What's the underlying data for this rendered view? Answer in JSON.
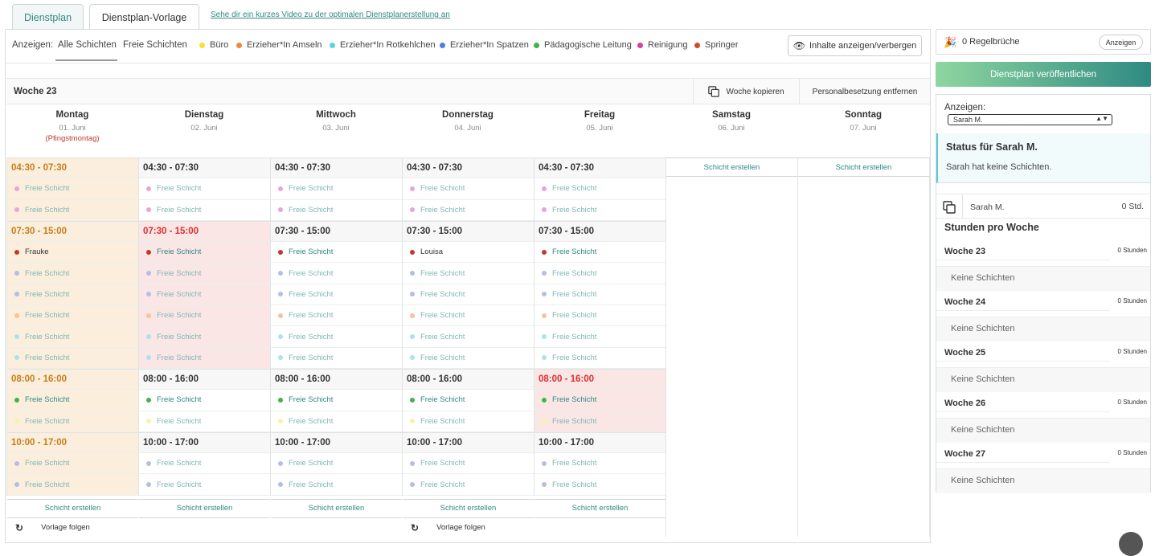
{
  "tabs": {
    "t1": "Dienstplan",
    "t2": "Dienstplan-Vorlage",
    "video": "Sehe dir ein kurzes Video zu der optimalen Dienstplanerstellung an"
  },
  "filter": {
    "show_label": "Anzeigen:",
    "all": "Alle Schichten",
    "free": "Freie Schichten",
    "toggle": "Inhalte anzeigen/verbergen",
    "legend": [
      {
        "label": "Büro",
        "color": "#f5e03c"
      },
      {
        "label": "Erzieher*In Amseln",
        "color": "#f0883a"
      },
      {
        "label": "Erzieher*In Rotkehlchen",
        "color": "#5cd2e6"
      },
      {
        "label": "Erzieher*In Spatzen",
        "color": "#4a7fe0"
      },
      {
        "label": "Pädagogische Leitung",
        "color": "#3fb34a"
      },
      {
        "label": "Reinigung",
        "color": "#d63fa4"
      },
      {
        "label": "Springer",
        "color": "#d24a2a"
      }
    ]
  },
  "week": {
    "label": "Woche 23",
    "copy": "Woche kopieren",
    "remove": "Personalbesetzung entfernen"
  },
  "days": [
    {
      "name": "Montag",
      "date": "01. Juni",
      "holiday": "(Pfingstmontag)"
    },
    {
      "name": "Dienstag",
      "date": "02. Juni",
      "holiday": ""
    },
    {
      "name": "Mittwoch",
      "date": "03. Juni",
      "holiday": ""
    },
    {
      "name": "Donnerstag",
      "date": "04. Juni",
      "holiday": ""
    },
    {
      "name": "Freitag",
      "date": "05. Juni",
      "holiday": ""
    },
    {
      "name": "Samstag",
      "date": "06. Juni",
      "holiday": ""
    },
    {
      "name": "Sonntag",
      "date": "07. Juni",
      "holiday": ""
    }
  ],
  "create_label": "Schicht erstellen",
  "follow_label": "Vorlage folgen",
  "free_label": "Freie Schicht",
  "colors": {
    "holiday_bg": "#fbeedd",
    "holiday_hdr": "#c57e1a",
    "alert_bg": "#fbe6e6",
    "alert_hdr": "#d93030",
    "accent": "#2e8a82",
    "pink": "#e8a5d5",
    "lavender": "#b5bde8",
    "peach": "#f6c39a",
    "cyan": "#a9e3ec",
    "green": "#3fb34a",
    "yellow": "#fbf2a8",
    "red": "#c0392b"
  },
  "schedule": [
    {
      "blocks": [
        {
          "time": "04:30 - 07:30",
          "slots": [
            {
              "c": "pink",
              "t": ""
            },
            {
              "c": "pink",
              "t": ""
            }
          ]
        },
        {
          "time": "07:30 - 15:00",
          "slots": [
            {
              "c": "red",
              "t": "Frauke"
            },
            {
              "c": "lavender",
              "t": ""
            },
            {
              "c": "lavender",
              "t": ""
            },
            {
              "c": "peach",
              "t": ""
            },
            {
              "c": "cyan",
              "t": ""
            },
            {
              "c": "cyan",
              "t": ""
            }
          ]
        },
        {
          "time": "08:00 - 16:00",
          "slots": [
            {
              "c": "green",
              "t": ""
            },
            {
              "c": "yellow",
              "t": ""
            }
          ]
        },
        {
          "time": "10:00 - 17:00",
          "slots": [
            {
              "c": "lavender",
              "t": ""
            },
            {
              "c": "lavender",
              "t": ""
            }
          ]
        }
      ]
    },
    {
      "blocks": [
        {
          "time": "04:30 - 07:30",
          "slots": [
            {
              "c": "pink",
              "t": ""
            },
            {
              "c": "pink",
              "t": ""
            }
          ]
        },
        {
          "time": "07:30 - 15:00",
          "slots": [
            {
              "c": "red",
              "t": ""
            },
            {
              "c": "lavender",
              "t": ""
            },
            {
              "c": "lavender",
              "t": ""
            },
            {
              "c": "peach",
              "t": ""
            },
            {
              "c": "cyan",
              "t": ""
            },
            {
              "c": "cyan",
              "t": ""
            }
          ]
        },
        {
          "time": "08:00 - 16:00",
          "slots": [
            {
              "c": "green",
              "t": ""
            },
            {
              "c": "yellow",
              "t": ""
            }
          ]
        },
        {
          "time": "10:00 - 17:00",
          "slots": [
            {
              "c": "lavender",
              "t": ""
            },
            {
              "c": "lavender",
              "t": ""
            }
          ]
        }
      ]
    },
    {
      "blocks": [
        {
          "time": "04:30 - 07:30",
          "slots": [
            {
              "c": "pink",
              "t": ""
            },
            {
              "c": "pink",
              "t": ""
            }
          ]
        },
        {
          "time": "07:30 - 15:00",
          "slots": [
            {
              "c": "red",
              "t": ""
            },
            {
              "c": "lavender",
              "t": ""
            },
            {
              "c": "lavender",
              "t": ""
            },
            {
              "c": "peach",
              "t": ""
            },
            {
              "c": "cyan",
              "t": ""
            },
            {
              "c": "cyan",
              "t": ""
            }
          ]
        },
        {
          "time": "08:00 - 16:00",
          "slots": [
            {
              "c": "green",
              "t": ""
            },
            {
              "c": "yellow",
              "t": ""
            }
          ]
        },
        {
          "time": "10:00 - 17:00",
          "slots": [
            {
              "c": "lavender",
              "t": ""
            },
            {
              "c": "lavender",
              "t": ""
            }
          ]
        }
      ]
    },
    {
      "blocks": [
        {
          "time": "04:30 - 07:30",
          "slots": [
            {
              "c": "pink",
              "t": ""
            },
            {
              "c": "pink",
              "t": ""
            }
          ]
        },
        {
          "time": "07:30 - 15:00",
          "slots": [
            {
              "c": "red",
              "t": "Louisa"
            },
            {
              "c": "lavender",
              "t": ""
            },
            {
              "c": "lavender",
              "t": ""
            },
            {
              "c": "peach",
              "t": ""
            },
            {
              "c": "cyan",
              "t": ""
            },
            {
              "c": "cyan",
              "t": ""
            }
          ]
        },
        {
          "time": "08:00 - 16:00",
          "slots": [
            {
              "c": "green",
              "t": ""
            },
            {
              "c": "yellow",
              "t": ""
            }
          ]
        },
        {
          "time": "10:00 - 17:00",
          "slots": [
            {
              "c": "lavender",
              "t": ""
            },
            {
              "c": "lavender",
              "t": ""
            }
          ]
        }
      ]
    },
    {
      "blocks": [
        {
          "time": "04:30 - 07:30",
          "slots": [
            {
              "c": "pink",
              "t": ""
            },
            {
              "c": "pink",
              "t": ""
            }
          ]
        },
        {
          "time": "07:30 - 15:00",
          "slots": [
            {
              "c": "red",
              "t": ""
            },
            {
              "c": "lavender",
              "t": ""
            },
            {
              "c": "lavender",
              "t": ""
            },
            {
              "c": "peach",
              "t": ""
            },
            {
              "c": "cyan",
              "t": ""
            },
            {
              "c": "cyan",
              "t": ""
            }
          ]
        },
        {
          "time": "08:00 - 16:00",
          "slots": [
            {
              "c": "green",
              "t": ""
            },
            {
              "c": "yellow",
              "t": ""
            }
          ]
        },
        {
          "time": "10:00 - 17:00",
          "slots": [
            {
              "c": "lavender",
              "t": ""
            },
            {
              "c": "lavender",
              "t": ""
            }
          ]
        }
      ]
    }
  ],
  "day_state": {
    "mon": "holiday",
    "tue_block2": "alert",
    "fri_block3": "alert"
  },
  "side": {
    "rules": "0 Regelbrüche",
    "rules_btn": "Anzeigen",
    "publish": "Dienstplan veröffentlichen",
    "show_label": "Anzeigen:",
    "select_value": "Sarah M.",
    "status_title": "Status für Sarah M.",
    "status_text": "Sarah hat keine Schichten.",
    "person": "Sarah M.",
    "person_hours": "0 Std.",
    "hpw_title": "Stunden pro Woche",
    "weeks": [
      {
        "name": "Woche 23",
        "hours": "0 Stunden",
        "empty": "Keine Schichten"
      },
      {
        "name": "Woche 24",
        "hours": "0 Stunden",
        "empty": "Keine Schichten"
      },
      {
        "name": "Woche 25",
        "hours": "0 Stunden",
        "empty": "Keine Schichten"
      },
      {
        "name": "Woche 26",
        "hours": "0 Stunden",
        "empty": "Keine Schichten"
      },
      {
        "name": "Woche 27",
        "hours": "0 Stunden",
        "empty": "Keine Schichten"
      }
    ]
  }
}
